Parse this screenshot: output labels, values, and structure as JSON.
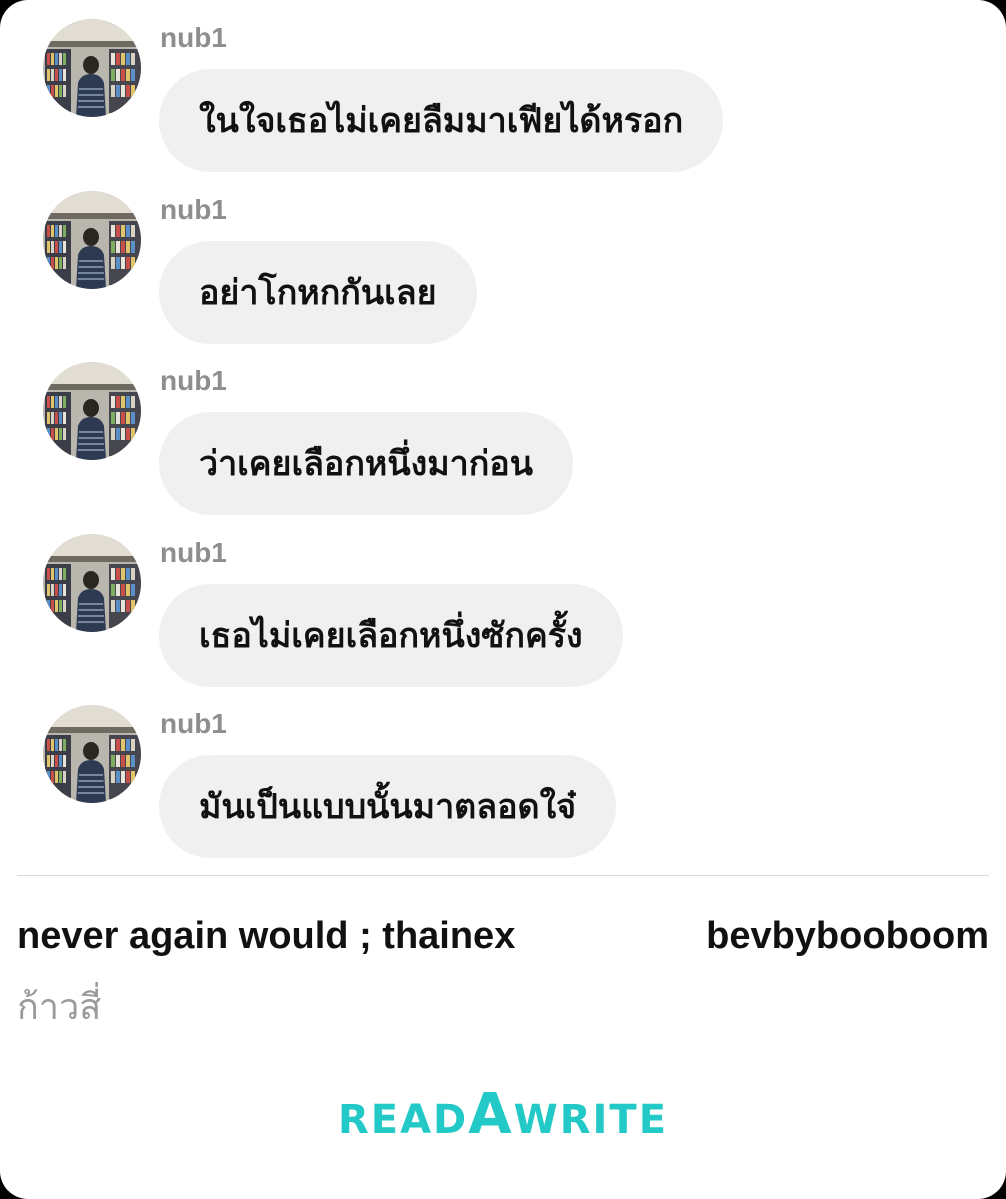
{
  "chat": {
    "messages": [
      {
        "sender": "nub1",
        "text": "ในใจเธอไม่เคยลืมมาเฟียได้หรอก"
      },
      {
        "sender": "nub1",
        "text": "อย่าโกหกกันเลย"
      },
      {
        "sender": "nub1",
        "text": "ว่าเคยเลือกหนึ่งมาก่อน"
      },
      {
        "sender": "nub1",
        "text": "เธอไม่เคยเลือกหนึ่งซักครั้ง"
      },
      {
        "sender": "nub1",
        "text": "มันเป็นแบบนั้นมาตลอดใจ๋"
      }
    ]
  },
  "footer": {
    "story_title": "never again would ; thainex",
    "author": "bevbybooboom",
    "chapter": "ก้าวสี่",
    "logo": {
      "part1": "READ",
      "part2": "A",
      "part3": "WRITE",
      "color": "#22c9c6"
    }
  },
  "colors": {
    "bubble": "#f0f0f0",
    "sender": "#8e8e8e",
    "text": "#111111",
    "accent": "#22c9c6"
  }
}
